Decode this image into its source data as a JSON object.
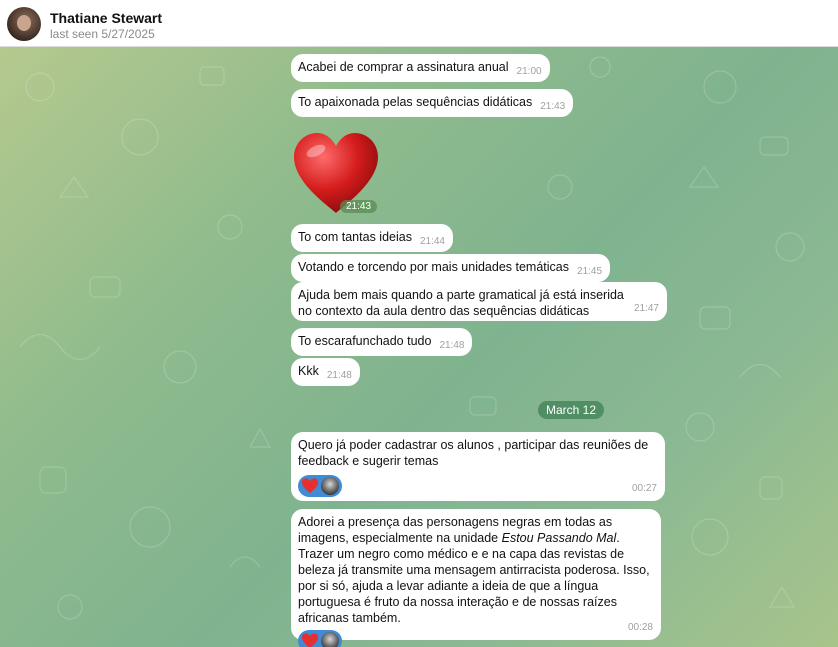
{
  "header": {
    "name": "Thatiane Stewart",
    "status": "last seen 5/27/2025"
  },
  "messages": [
    {
      "text": "Acabei de comprar a assinatura anual",
      "time": "21:00"
    },
    {
      "text": "To apaixonada pelas sequências didáticas",
      "time": "21:43"
    },
    {
      "text": "To com tantas ideias",
      "time": "21:44"
    },
    {
      "text": "Votando e torcendo por mais unidades temáticas",
      "time": "21:45"
    },
    {
      "text": "Ajuda bem mais quando a parte gramatical já está inserida no contexto da aula dentro das sequências didáticas",
      "time": "21:47"
    },
    {
      "text": "To escarafunchado tudo",
      "time": "21:48"
    },
    {
      "text": "Kkk",
      "time": "21:48"
    },
    {
      "text": "Quero já poder cadastrar os alunos , participar das reuniões de feedback e sugerir temas",
      "time": "00:27"
    },
    {
      "text_before": "Adorei a presença das personagens negras em todas as imagens, especialmente na unidade ",
      "text_italic": "Estou Passando Mal",
      "text_after": ". Trazer um negro como médico e e na capa das revistas de beleza já transmite uma mensagem antirracista poderosa. Isso, por si só, ajuda a levar adiante a ideia de que a língua portuguesa é fruto da nossa interação e de nossas raízes africanas também.",
      "time": "00:28"
    }
  ],
  "sticker": {
    "emoji": "heart",
    "time": "21:43"
  },
  "date_separator": "March 12",
  "colors": {
    "accent": "#3f8bd6",
    "bubble": "#ffffff",
    "date_pill": "#46875a"
  }
}
